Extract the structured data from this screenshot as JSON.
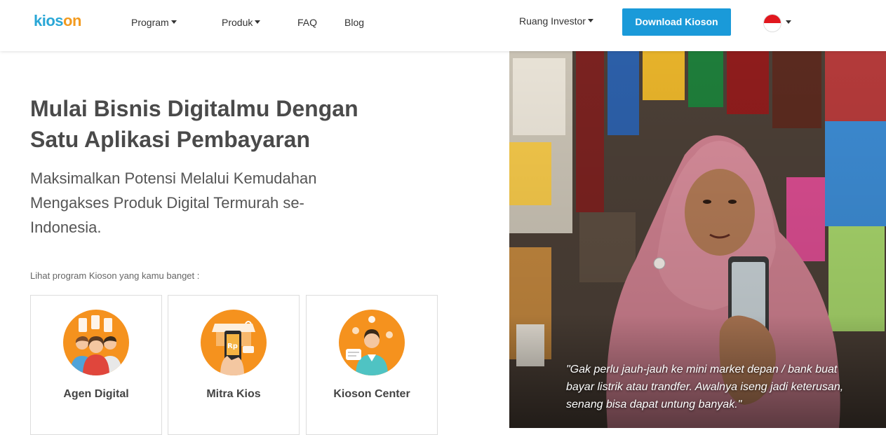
{
  "nav": {
    "logo_part1": "kios",
    "logo_part2": "on",
    "program": "Program",
    "produk": "Produk",
    "faq": "FAQ",
    "blog": "Blog",
    "ruang_investor": "Ruang Investor",
    "download": "Download Kioson",
    "language_flag": "indonesia-flag-icon"
  },
  "hero": {
    "title_line1": "Mulai Bisnis Digitalmu Dengan",
    "title_line2": "Satu Aplikasi Pembayaran",
    "subtitle": "Maksimalkan Potensi Melalui Kemudahan Mengakses Produk Digital Termurah se-Indonesia.",
    "program_label": "Lihat program Kioson yang kamu banget :"
  },
  "cards": [
    {
      "title": "Agen Digital",
      "icon": "agen-digital-icon"
    },
    {
      "title": "Mitra Kios",
      "icon": "mitra-kios-icon"
    },
    {
      "title": "Kioson Center",
      "icon": "kioson-center-icon"
    }
  ],
  "photo": {
    "quote": "\"Gak perlu jauh-jauh ke mini market depan / bank buat bayar listrik atau trandfer. Awalnya iseng jadi keterusan, senang bisa dapat untung banyak.\""
  },
  "colors": {
    "brand_blue": "#2aa7d6",
    "brand_orange": "#f39a1e",
    "button_blue": "#1a9ad9"
  }
}
